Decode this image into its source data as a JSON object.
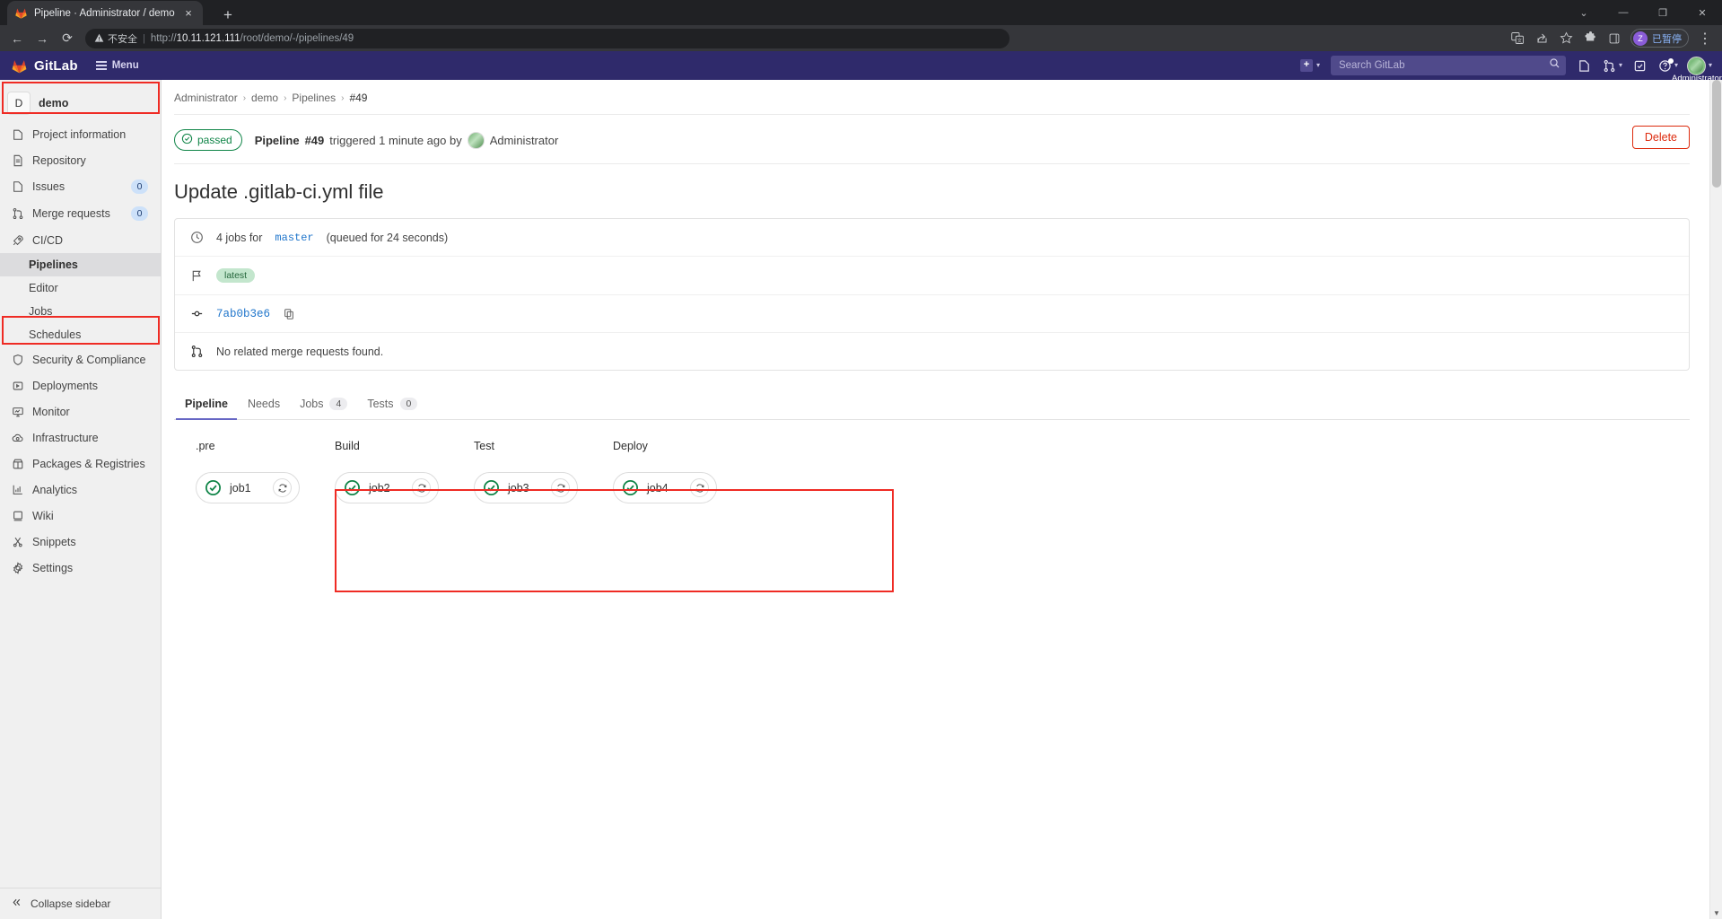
{
  "browser": {
    "tab": {
      "title": "Pipeline · Administrator / demo",
      "favicon": "gitlab-favicon",
      "close": "×"
    },
    "new_tab": "+",
    "window_controls": {
      "more": "⌄",
      "minimize": "—",
      "maximize": "❐",
      "close": "✕"
    },
    "nav": {
      "back": "←",
      "forward": "→",
      "reload": "⟳"
    },
    "omnibox": {
      "security_label": "不安全",
      "url_prefix": "http://",
      "url_host": "10.11.121.111",
      "url_path": "/root/demo/-/pipelines/49",
      "full_url": "http://10.11.121.111/root/demo/-/pipelines/49"
    },
    "toolbar_icons": [
      "translate-icon",
      "share-icon",
      "bookmark-star-icon",
      "extensions-puzzle-icon",
      "sidepanel-icon"
    ],
    "profile": {
      "initial": "Z",
      "label": "已暂停"
    },
    "menu": "⋮"
  },
  "gitlab_nav": {
    "brand": "GitLab",
    "menu_label": "Menu",
    "create_label": "+",
    "search": {
      "placeholder": "Search GitLab",
      "value": ""
    },
    "icons": [
      "issues-icon",
      "merge-requests-icon",
      "todos-icon",
      "help-icon"
    ],
    "user_name": "Administrator"
  },
  "sidebar": {
    "project": {
      "initial": "D",
      "name": "demo"
    },
    "items": [
      {
        "label": "Project information",
        "icon": "info-icon",
        "badge": null
      },
      {
        "label": "Repository",
        "icon": "document-icon",
        "badge": null
      },
      {
        "label": "Issues",
        "icon": "issues-icon",
        "badge": "0"
      },
      {
        "label": "Merge requests",
        "icon": "merge-icon",
        "badge": "0"
      },
      {
        "label": "CI/CD",
        "icon": "rocket-icon",
        "badge": null
      }
    ],
    "cicd_sub": [
      {
        "label": "Pipelines",
        "active": true
      },
      {
        "label": "Editor",
        "active": false
      },
      {
        "label": "Jobs",
        "active": false
      },
      {
        "label": "Schedules",
        "active": false
      }
    ],
    "items_lower": [
      {
        "label": "Security & Compliance",
        "icon": "shield-icon"
      },
      {
        "label": "Deployments",
        "icon": "deployments-icon"
      },
      {
        "label": "Monitor",
        "icon": "monitor-icon"
      },
      {
        "label": "Infrastructure",
        "icon": "cloud-gear-icon"
      },
      {
        "label": "Packages & Registries",
        "icon": "package-icon"
      },
      {
        "label": "Analytics",
        "icon": "chart-icon"
      },
      {
        "label": "Wiki",
        "icon": "book-icon"
      },
      {
        "label": "Snippets",
        "icon": "scissors-icon"
      },
      {
        "label": "Settings",
        "icon": "gear-icon"
      }
    ],
    "collapse": "Collapse sidebar"
  },
  "breadcrumb": {
    "items": [
      "Administrator",
      "demo",
      "Pipelines",
      "#49"
    ],
    "separator": "›"
  },
  "pipeline": {
    "status": "passed",
    "status_color": "#108548",
    "prefix": "Pipeline",
    "id": "#49",
    "triggered_text": "triggered 1 minute ago by",
    "author": "Administrator",
    "delete_label": "Delete",
    "delete_color": "#dd2b0e",
    "title": "Update .gitlab-ci.yml file",
    "info": {
      "jobs_count_text": "4 jobs for",
      "ref": "master",
      "queued_text": "(queued for 24 seconds)",
      "tag": "latest",
      "commit_sha": "7ab0b3e6",
      "merge_requests_text": "No related merge requests found."
    },
    "tabs": [
      {
        "label": "Pipeline",
        "count": null,
        "active": true
      },
      {
        "label": "Needs",
        "count": null,
        "active": false
      },
      {
        "label": "Jobs",
        "count": "4",
        "active": false
      },
      {
        "label": "Tests",
        "count": "0",
        "active": false
      }
    ],
    "graph": {
      "stages": [
        {
          "name": ".pre",
          "jobs": [
            {
              "name": "job1",
              "status": "success"
            }
          ]
        },
        {
          "name": "Build",
          "jobs": [
            {
              "name": "job2",
              "status": "success"
            }
          ]
        },
        {
          "name": "Test",
          "jobs": [
            {
              "name": "job3",
              "status": "success"
            }
          ]
        },
        {
          "name": "Deploy",
          "jobs": [
            {
              "name": "job4",
              "status": "success"
            }
          ]
        }
      ]
    }
  }
}
